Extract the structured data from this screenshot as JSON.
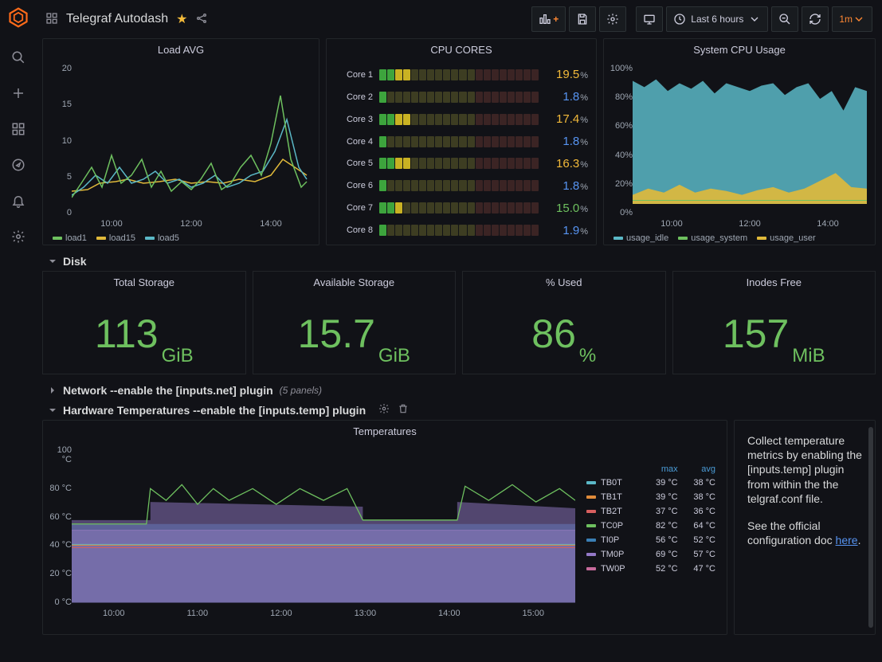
{
  "header": {
    "title": "Telegraf Autodash",
    "time_range": "Last 6 hours",
    "refresh_interval": "1m"
  },
  "nav": {
    "items": [
      "search",
      "add",
      "grid",
      "compass",
      "bell",
      "gear"
    ]
  },
  "panels": {
    "load": {
      "title": "Load AVG",
      "legend": [
        "load1",
        "load15",
        "load5"
      ],
      "yticks": [
        "20",
        "15",
        "10",
        "5",
        "0"
      ],
      "xticks": [
        "10:00",
        "12:00",
        "14:00"
      ]
    },
    "cores": {
      "title": "CPU CORES",
      "rows": [
        {
          "label": "Core 1",
          "value": "19.5",
          "cls": "cv-y",
          "lit": 4
        },
        {
          "label": "Core 2",
          "value": "1.8",
          "cls": "cv-b",
          "lit": 1
        },
        {
          "label": "Core 3",
          "value": "17.4",
          "cls": "cv-y",
          "lit": 4
        },
        {
          "label": "Core 4",
          "value": "1.8",
          "cls": "cv-b",
          "lit": 1
        },
        {
          "label": "Core 5",
          "value": "16.3",
          "cls": "cv-y",
          "lit": 4
        },
        {
          "label": "Core 6",
          "value": "1.8",
          "cls": "cv-b",
          "lit": 1
        },
        {
          "label": "Core 7",
          "value": "15.0",
          "cls": "cv-g",
          "lit": 3
        },
        {
          "label": "Core 8",
          "value": "1.9",
          "cls": "cv-b",
          "lit": 1
        }
      ]
    },
    "syscpu": {
      "title": "System CPU Usage",
      "legend": [
        "usage_idle",
        "usage_system",
        "usage_user"
      ],
      "yticks": [
        "100%",
        "80%",
        "60%",
        "40%",
        "20%",
        "0%"
      ],
      "xticks": [
        "10:00",
        "12:00",
        "14:00"
      ]
    }
  },
  "sections": {
    "disk": "Disk",
    "network": "Network --enable the [inputs.net] plugin",
    "network_panels": "(5 panels)",
    "temps": "Hardware Temperatures --enable the [inputs.temp] plugin"
  },
  "disk": {
    "total": {
      "title": "Total Storage",
      "value": "113",
      "unit": "GiB"
    },
    "avail": {
      "title": "Available Storage",
      "value": "15.7",
      "unit": "GiB"
    },
    "used": {
      "title": "% Used",
      "value": "86",
      "unit": "%"
    },
    "inodes": {
      "title": "Inodes Free",
      "value": "157",
      "unit": "MiB"
    }
  },
  "temps": {
    "title": "Temperatures",
    "yticks": [
      "100 °C",
      "80 °C",
      "60 °C",
      "40 °C",
      "20 °C",
      "0 °C"
    ],
    "xticks": [
      "10:00",
      "11:00",
      "12:00",
      "13:00",
      "14:00",
      "15:00"
    ],
    "cols": [
      "max",
      "avg"
    ],
    "rows": [
      {
        "name": "TB0T",
        "max": "39 °C",
        "avg": "38 °C",
        "color": "#5bb8c7"
      },
      {
        "name": "TB1T",
        "max": "39 °C",
        "avg": "38 °C",
        "color": "#e08b3a"
      },
      {
        "name": "TB2T",
        "max": "37 °C",
        "avg": "36 °C",
        "color": "#d85f5f"
      },
      {
        "name": "TC0P",
        "max": "82 °C",
        "avg": "64 °C",
        "color": "#6ec05f"
      },
      {
        "name": "TI0P",
        "max": "56 °C",
        "avg": "52 °C",
        "color": "#3a7fb5"
      },
      {
        "name": "TM0P",
        "max": "69 °C",
        "avg": "57 °C",
        "color": "#9479c7"
      },
      {
        "name": "TW0P",
        "max": "52 °C",
        "avg": "47 °C",
        "color": "#c76a9b"
      }
    ]
  },
  "info": {
    "text": "Collect temperature metrics by enabling the [inputs.temp] plugin from within the the telgraf.conf file.",
    "text2": "See the official configuration doc ",
    "link": "here"
  },
  "chart_data": [
    {
      "type": "line",
      "title": "Load AVG",
      "x_range": [
        "09:30",
        "15:00"
      ],
      "ylim": [
        0,
        20
      ],
      "xticks": [
        "10:00",
        "12:00",
        "14:00"
      ],
      "series": [
        {
          "name": "load1",
          "color": "#6ec05f",
          "approx_values": [
            2,
            3,
            5,
            4,
            6,
            3,
            4,
            7,
            5,
            3,
            4,
            9,
            17,
            7
          ]
        },
        {
          "name": "load15",
          "color": "#e0b93a",
          "approx_values": [
            2,
            2.5,
            3,
            3,
            3.5,
            3,
            3,
            3.5,
            3.5,
            3,
            3,
            4,
            5,
            5
          ]
        },
        {
          "name": "load5",
          "color": "#5bb8c7",
          "approx_values": [
            2,
            3,
            4,
            3.5,
            4.5,
            3,
            3.5,
            5,
            4,
            3,
            3.5,
            6,
            9,
            6
          ]
        }
      ]
    },
    {
      "type": "bar",
      "title": "CPU CORES",
      "categories": [
        "Core 1",
        "Core 2",
        "Core 3",
        "Core 4",
        "Core 5",
        "Core 6",
        "Core 7",
        "Core 8"
      ],
      "values": [
        19.5,
        1.8,
        17.4,
        1.8,
        16.3,
        1.8,
        15.0,
        1.9
      ],
      "unit": "%"
    },
    {
      "type": "area",
      "title": "System CPU Usage",
      "x_range": [
        "09:30",
        "15:00"
      ],
      "ylim": [
        0,
        100
      ],
      "xticks": [
        "10:00",
        "12:00",
        "14:00"
      ],
      "series": [
        {
          "name": "usage_idle",
          "color": "#5bb8c7",
          "approx_values": [
            88,
            85,
            82,
            84,
            86,
            83,
            85,
            80,
            84,
            86,
            82,
            78,
            70,
            80
          ]
        },
        {
          "name": "usage_system",
          "color": "#6ec05f",
          "approx_values": [
            4,
            5,
            6,
            5,
            5,
            6,
            5,
            7,
            5,
            5,
            6,
            8,
            10,
            7
          ]
        },
        {
          "name": "usage_user",
          "color": "#e0b93a",
          "approx_values": [
            8,
            10,
            12,
            11,
            9,
            11,
            10,
            13,
            11,
            9,
            12,
            14,
            20,
            13
          ]
        }
      ]
    },
    {
      "type": "line",
      "title": "Temperatures",
      "x_range": [
        "09:30",
        "15:30"
      ],
      "ylim": [
        0,
        100
      ],
      "unit": "°C",
      "xticks": [
        "10:00",
        "11:00",
        "12:00",
        "13:00",
        "14:00",
        "15:00"
      ],
      "series": [
        {
          "name": "TB0T",
          "max": 39,
          "avg": 38,
          "color": "#5bb8c7"
        },
        {
          "name": "TB1T",
          "max": 39,
          "avg": 38,
          "color": "#e08b3a"
        },
        {
          "name": "TB2T",
          "max": 37,
          "avg": 36,
          "color": "#d85f5f"
        },
        {
          "name": "TC0P",
          "max": 82,
          "avg": 64,
          "color": "#6ec05f"
        },
        {
          "name": "TI0P",
          "max": 56,
          "avg": 52,
          "color": "#3a7fb5"
        },
        {
          "name": "TM0P",
          "max": 69,
          "avg": 57,
          "color": "#9479c7"
        },
        {
          "name": "TW0P",
          "max": 52,
          "avg": 47,
          "color": "#c76a9b"
        }
      ]
    }
  ]
}
